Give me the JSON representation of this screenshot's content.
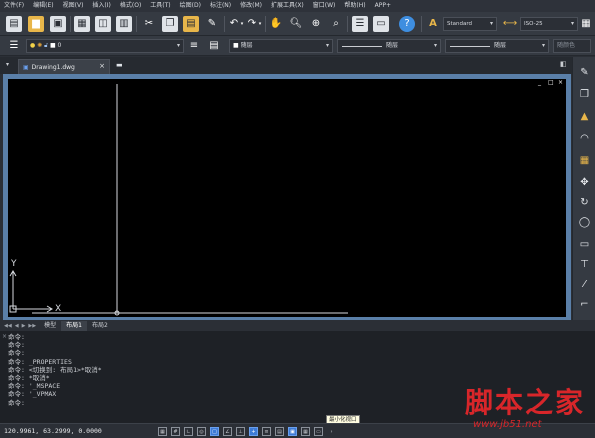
{
  "menu": [
    "文件(F)",
    "编辑(E)",
    "视图(V)",
    "插入(I)",
    "格式(O)",
    "工具(T)",
    "绘图(D)",
    "标注(N)",
    "修改(M)",
    "扩展工具(X)",
    "窗口(W)",
    "帮助(H)",
    "APP+"
  ],
  "toolbar1": {
    "text_style": "Standard",
    "dim_style": "ISO-25"
  },
  "toolbar2": {
    "layer_value": "0",
    "color_value": "随层",
    "linetype_value": "随层",
    "lineweight_value": "随层",
    "plotstyle_value": "随颜色"
  },
  "tab": {
    "doc_name": "Drawing1.dwg"
  },
  "axes": {
    "y": "Y",
    "x": "X"
  },
  "window_controls": [
    "_",
    "□",
    "×"
  ],
  "layout_tabs": [
    "模型",
    "布局1",
    "布局2"
  ],
  "layout_active": "布局1",
  "command_lines": [
    "命令:",
    "命令:",
    "命令:",
    "命令: _PROPERTIES",
    "命令: <切换到: 布局1>*取消*",
    "命令: *取消*",
    "命令: '_MSPACE",
    "命令: '_VPMAX",
    "命令:"
  ],
  "tooltip": "最小化视口",
  "status": {
    "coords": "120.9961, 63.2999, 0.0000"
  },
  "watermark": {
    "title": "脚本之家",
    "url": "www.jb51.net"
  },
  "colors": {
    "ui_bg": "#2b2f36",
    "canvas_bg": "#000000",
    "viewport_border": "#5a7fa8",
    "accent": "#3e7bd6",
    "watermark": "#d8262a"
  }
}
